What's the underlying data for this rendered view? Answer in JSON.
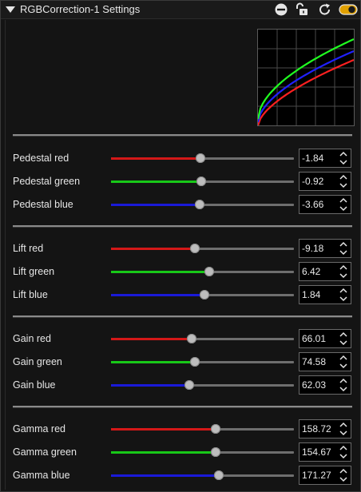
{
  "window": {
    "title": "RGBCorrection-1 Settings",
    "icons": [
      "collapse-arrow-icon",
      "remove-icon",
      "unlock-icon",
      "reset-icon",
      "toggle-icon"
    ]
  },
  "colors": {
    "red": "#d41818",
    "green": "#18c818",
    "blue": "#1a1ad8",
    "curve_red": "#ff2020",
    "curve_green": "#20ff20",
    "curve_blue": "#2020ff",
    "toggle": "#e0a000"
  },
  "groups": [
    {
      "name": "pedestal",
      "params": [
        {
          "label": "Pedestal red",
          "value": "-1.84",
          "channel": "red",
          "level": 0.49
        },
        {
          "label": "Pedestal green",
          "value": "-0.92",
          "channel": "green",
          "level": 0.495
        },
        {
          "label": "Pedestal blue",
          "value": "-3.66",
          "channel": "blue",
          "level": 0.485
        }
      ]
    },
    {
      "name": "lift",
      "params": [
        {
          "label": "Lift red",
          "value": "-9.18",
          "channel": "red",
          "level": 0.46
        },
        {
          "label": "Lift green",
          "value": "6.42",
          "channel": "green",
          "level": 0.535
        },
        {
          "label": "Lift blue",
          "value": "1.84",
          "channel": "blue",
          "level": 0.51
        }
      ]
    },
    {
      "name": "gain",
      "params": [
        {
          "label": "Gain red",
          "value": "66.01",
          "channel": "red",
          "level": 0.44
        },
        {
          "label": "Gain green",
          "value": "74.58",
          "channel": "green",
          "level": 0.46
        },
        {
          "label": "Gain blue",
          "value": "62.03",
          "channel": "blue",
          "level": 0.43
        }
      ]
    },
    {
      "name": "gamma",
      "params": [
        {
          "label": "Gamma red",
          "value": "158.72",
          "channel": "red",
          "level": 0.57
        },
        {
          "label": "Gamma green",
          "value": "154.67",
          "channel": "green",
          "level": 0.57
        },
        {
          "label": "Gamma blue",
          "value": "171.27",
          "channel": "blue",
          "level": 0.59
        }
      ]
    }
  ]
}
